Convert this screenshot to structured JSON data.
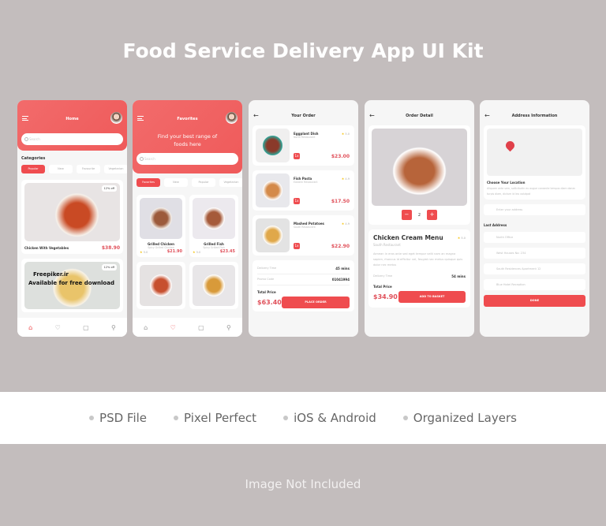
{
  "title": "Food Service Delivery App UI Kit",
  "colors": {
    "accent": "#ef4c4f",
    "background": "#c3bdbd",
    "price": "#e0505a"
  },
  "home": {
    "title": "Home",
    "search_placeholder": "Search",
    "categories_label": "Categories",
    "chips": [
      "Popular",
      "New",
      "Favourite",
      "Vegetarian"
    ],
    "items": [
      {
        "name": "Chicken With Vegetables",
        "price": "$38.90",
        "badge": "12% off"
      },
      {
        "name": "",
        "price": "",
        "badge": "12% off"
      }
    ]
  },
  "favorites": {
    "title": "Favorites",
    "headline": "Find your best range of foods here",
    "search_placeholder": "Search",
    "chips": [
      "Favorites",
      "New",
      "Popular",
      "Vegetarian"
    ],
    "items": [
      {
        "name": "Grilled Chicken",
        "sub": "Spicy Grilled Chicken",
        "rating": "5.0",
        "price": "$21.90"
      },
      {
        "name": "Grilled Fish",
        "sub": "Spicy Grilled Fish",
        "rating": "5.0",
        "price": "$23.45"
      }
    ]
  },
  "order": {
    "title": "Your Order",
    "items": [
      {
        "name": "Eggplant Dish",
        "restaurant": "North Restaurant",
        "rating": "5.0",
        "qty": "1x",
        "price": "$23.00"
      },
      {
        "name": "Fish Pasta",
        "restaurant": "Eastern Restaurant",
        "rating": "4.9",
        "qty": "1x",
        "price": "$17.50"
      },
      {
        "name": "Mashed Potatoes",
        "restaurant": "South Restaurant",
        "rating": "4.9",
        "qty": "1x",
        "price": "$22.90"
      }
    ],
    "delivery_label": "Delivery Time",
    "delivery_value": "45 mins",
    "promo_label": "Promo Code",
    "promo_value": "01041994",
    "total_label": "Total Price",
    "total": "$63.40",
    "button": "PLACE ORDER"
  },
  "detail": {
    "title": "Order Detail",
    "qty": "2",
    "minus": "−",
    "plus": "+",
    "name": "Chicken Cream Menu",
    "restaurant": "South Restaurant",
    "rating": "5.0",
    "description": "Aenean in eros ante sed eget tempor velit nam an magna sapien, rhoncus id efficitur vel, feugiat nec metus quisque quis dolor nec metus",
    "delivery_label": "Delivery Time",
    "delivery_value": "54 mins",
    "total_label": "Total Price",
    "total": "$34.90",
    "button": "ADD TO BASKET"
  },
  "address": {
    "title": "Address Information",
    "choose_label": "Choose Your Location",
    "choose_text": "Aliquam ante sem, sollicitudin eu augue consecte tempus diam donec turpis diam, dictum id leo volutpat",
    "input_placeholder": "Enter your address",
    "last_label": "Last Address",
    "list": [
      "North Office",
      "West Houses No: 234",
      "South Residences Apartment 12",
      "Blue Hotel Reception"
    ],
    "button": "DONE"
  },
  "features": [
    "PSD File",
    "Pixel Perfect",
    "iOS & Android",
    "Organized Layers"
  ],
  "footer": "Image Not Included",
  "watermark": [
    "Freepiker.ir",
    "Available for free download"
  ]
}
